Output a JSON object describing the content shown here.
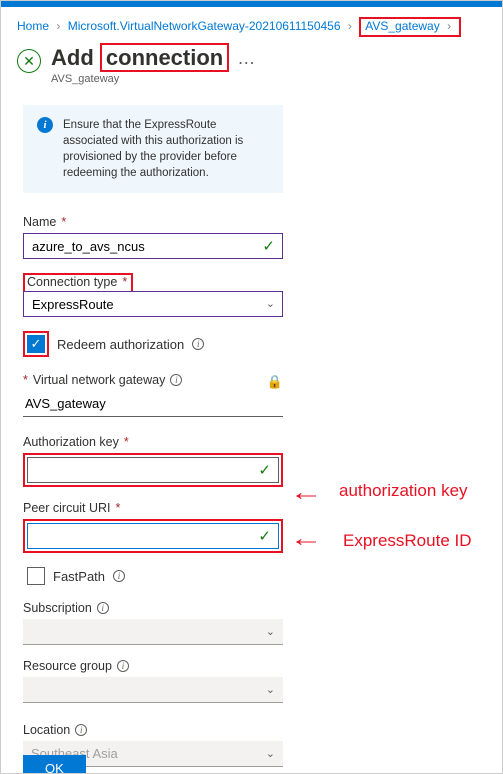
{
  "breadcrumb": {
    "home": "Home",
    "resource": "Microsoft.VirtualNetworkGateway-20210611150456",
    "current": "AVS_gateway"
  },
  "header": {
    "title_prefix": "Add",
    "title_boxed": "connection",
    "subtitle": "AVS_gateway"
  },
  "info": {
    "text": "Ensure that the ExpressRoute associated with this authorization is provisioned by the provider before redeeming the authorization."
  },
  "fields": {
    "name": {
      "label": "Name",
      "value": "azure_to_avs_ncus"
    },
    "conn_type": {
      "label": "Connection type",
      "value": "ExpressRoute"
    },
    "redeem": {
      "label": "Redeem authorization",
      "checked": true
    },
    "vng": {
      "label": "Virtual network gateway",
      "value": "AVS_gateway"
    },
    "auth_key": {
      "label": "Authorization key",
      "value": ""
    },
    "peer_uri": {
      "label": "Peer circuit URI",
      "value": ""
    },
    "fastpath": {
      "label": "FastPath",
      "checked": false
    },
    "subscription": {
      "label": "Subscription",
      "value": ""
    },
    "rg": {
      "label": "Resource group",
      "value": ""
    },
    "location": {
      "label": "Location",
      "value": "Southeast Asia"
    }
  },
  "annotations": {
    "auth_key": "authorization key",
    "express_id": "ExpressRoute ID"
  },
  "buttons": {
    "ok": "OK"
  }
}
